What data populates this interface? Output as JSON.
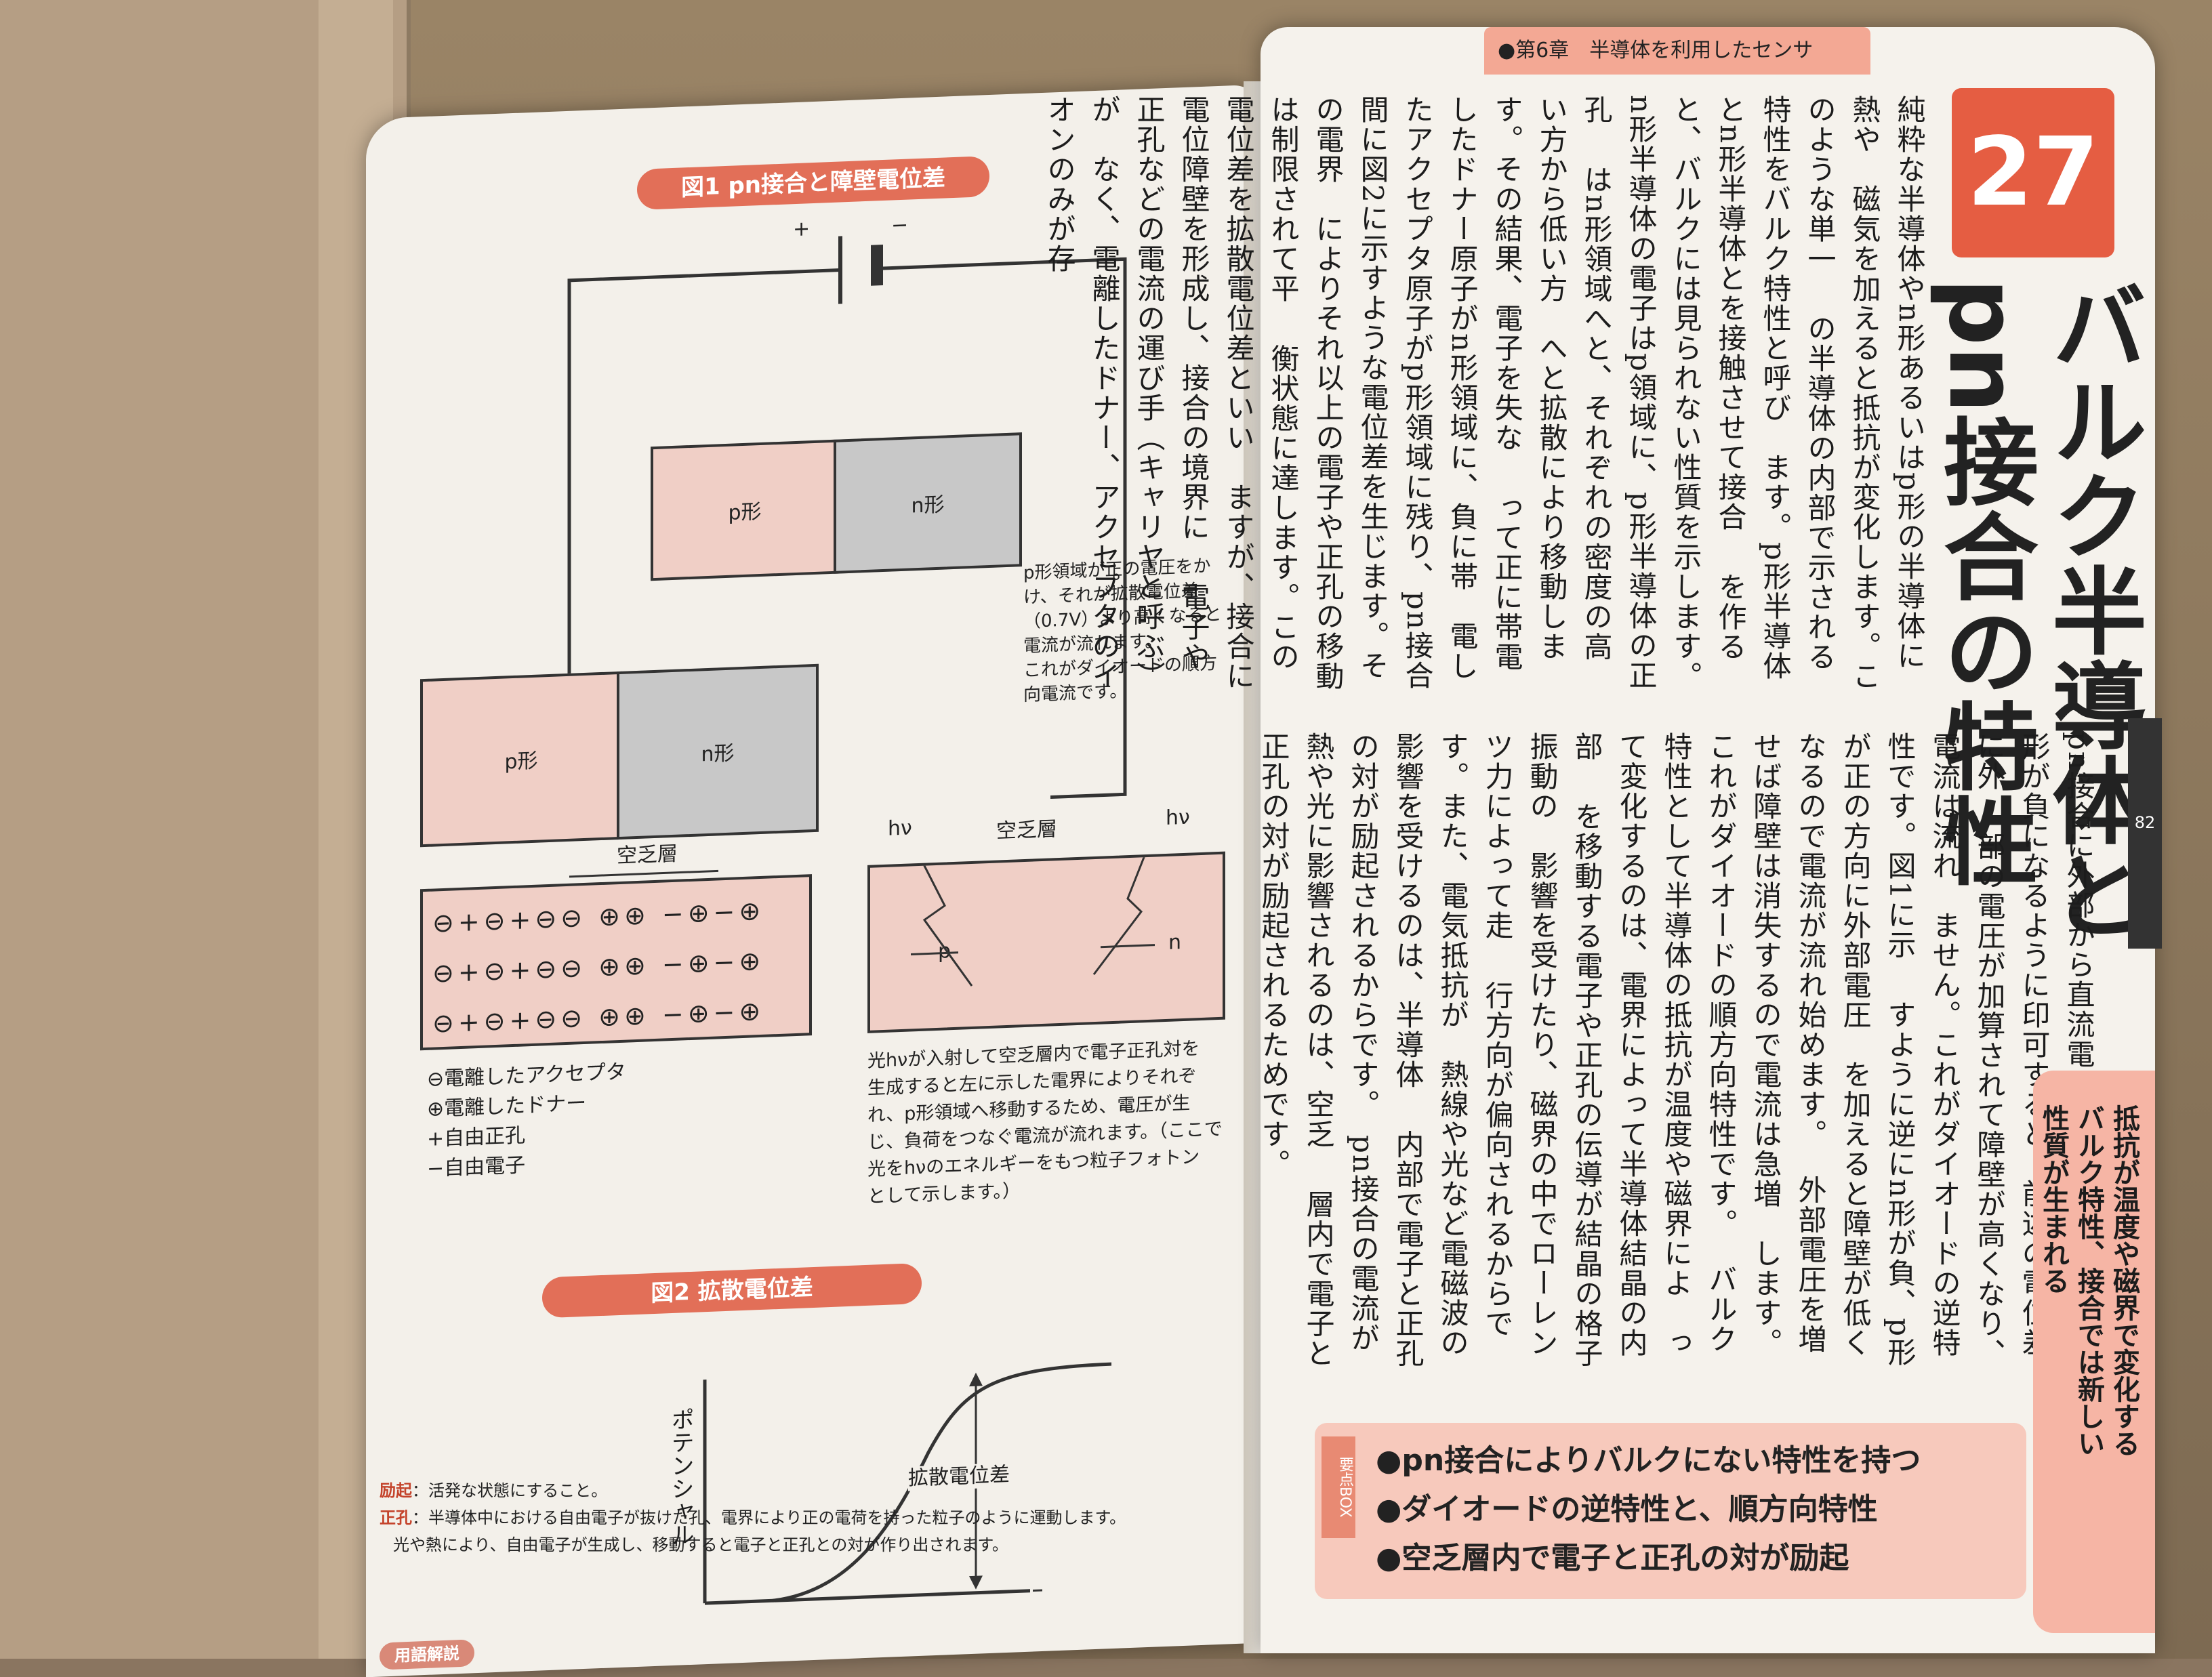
{
  "left_page": {
    "fig1_title": "図1 pn接合と障壁電位差",
    "battery_plus": "+",
    "battery_minus": "−",
    "p_label": "p形",
    "n_label": "n形",
    "fig1_note": [
      "p形領域が正の電圧をか",
      "け、それが拡散電位差",
      "（0.7V）より高くなると",
      "電流が流れます。",
      "これがダイオードの順方",
      "向電流です。"
    ],
    "depletion_label": "空乏層",
    "legend": [
      "⊖電離したアクセプタ",
      "⊕電離したドナー",
      "+自由正孔",
      "−自由電子"
    ],
    "photo_depletion_label": "空乏層",
    "hv_left": "hν",
    "hv_right": "hν",
    "photo_p": "p",
    "photo_n": "n",
    "photo_note": [
      "光hνが入射して空乏層内で電子正孔対を",
      "生成すると左に示した電界によりそれぞ",
      "れ、p形領域へ移動するため、電圧が生",
      "じ、負荷をつなぐ電流が流れます。（ここで",
      "光をhνのエネルギーをもつ粒子フォトン",
      "として示します。）"
    ],
    "fig2_title": "図2 拡散電位差",
    "fig2_ylabel": "ポテンシャル",
    "fig2_annotation": "拡散電位差",
    "glossary_title": "用語解説",
    "glossary": [
      {
        "term": "励起",
        "text": "：活発な状態にすること。"
      },
      {
        "term": "正孔",
        "text": "：半導体中における自由電子が抜けた孔、電界により正の電荷を持った粒子のように運動します。"
      },
      {
        "term": "",
        "text": "光や熱により、自由電子が生成し、移動すると電子と正孔との対が作り出されます。"
      }
    ]
  },
  "right_page": {
    "chapter_header": "●第6章　半導体を利用したセンサ",
    "section_number": "27",
    "title_line1": "バルク半導体と",
    "title_line2": "pn接合の特性",
    "page_number": "82",
    "upper_text": [
      "純粋な半導体やn形あるいはp形の半導体に熱や",
      "磁気を加えると抵抗が変化します。このような単一",
      "の半導体の内部で示される特性をバルク特性と呼び",
      "ます。p形半導体とn形半導体とを接触させて接合",
      "を作ると、バルクには見られない性質を示します。",
      "n形半導体の電子はp領域に、p形半導体の正孔",
      "はn形領域へと、それぞれの密度の高い方から低い方",
      "へと拡散により移動します。その結果、電子を失な",
      "って正に帯電したドナー原子がn形領域に、負に帯",
      "電したアクセプタ原子がp形領域に残り、pn接合",
      "間に図2に示すような電位差を生じます。その電界",
      "によりそれ以上の電子や正孔の移動は制限されて平",
      "衡状態に達します。この電位差を拡散電位差といい",
      "ますが、接合に電位障壁を形成し、接合の境界に",
      "電子や正孔などの電流の運び手（キャリヤと呼ぶ）が",
      "なく、電離したドナー、アクセプタのイオンのみが存"
    ],
    "lower_text": [
      "pn接合に外部から直流電圧をn形領域が正、p",
      "形が負になるように印可すると、前述の電位差に外",
      "部の電圧が加算されて障壁が高くなり、電流は流れ",
      "ません。これがダイオードの逆特性です。図1に示",
      "すように逆にn形が負、p形が正の方向に外部電圧",
      "を加えると障壁が低くなるので電流が流れ始めます。",
      "外部電圧を増せば障壁は消失するので電流は急増",
      "します。これがダイオードの順方向特性です。",
      "バルク特性として半導体の抵抗が温度や磁界によ",
      "って変化するのは、電界によって半導体結晶の内部",
      "を移動する電子や正孔の伝導が結晶の格子振動の",
      "影響を受けたり、磁界の中でローレンツ力によって走",
      "行方向が偏向されるからです。また、電気抵抗が",
      "熱線や光など電磁波の影響を受けるのは、半導体",
      "内部で電子と正孔の対が励起されるからです。",
      "pn接合の電流が熱や光に影響されるのは、空乏",
      "層内で電子と正孔の対が励起されるためです。"
    ],
    "side_tab": [
      "抵抗が温度や磁界で変化する",
      "バルク特性、接合では新しい",
      "性質が生まれる"
    ],
    "summary": [
      "●pn接合によりバルクにない特性を持つ",
      "●ダイオードの逆特性と、順方向特性",
      "●空乏層内で電子と正孔の対が励起"
    ],
    "summary_tag": "要点BOX"
  }
}
